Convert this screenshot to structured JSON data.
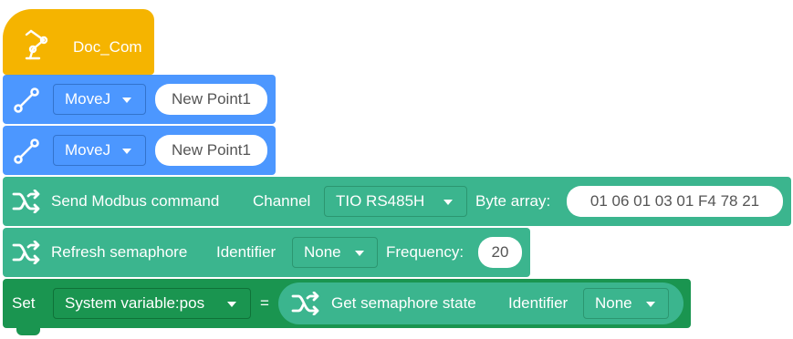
{
  "hat": {
    "title": "Doc_Com",
    "icon": "robot-arm-icon"
  },
  "move_blocks": [
    {
      "mode": "MoveJ",
      "point": "New Point1",
      "icon": "path-line-icon"
    },
    {
      "mode": "MoveJ",
      "point": "New Point1",
      "icon": "path-line-icon"
    }
  ],
  "modbus": {
    "icon": "shuffle-icon",
    "label": "Send Modbus command",
    "channel_label": "Channel",
    "channel_value": "TIO RS485H",
    "bytes_label": "Byte array:",
    "bytes_value": "01 06 01 03 01 F4 78 21"
  },
  "refresh": {
    "icon": "shuffle-icon",
    "label": "Refresh semaphore",
    "identifier_label": "Identifier",
    "identifier_value": "None",
    "frequency_label": "Frequency:",
    "frequency_value": "20"
  },
  "set_block": {
    "label": "Set",
    "variable": "System variable:pos",
    "equals": "=",
    "get": {
      "icon": "shuffle-icon",
      "label": "Get semaphore state",
      "identifier_label": "Identifier",
      "identifier_value": "None"
    }
  },
  "colors": {
    "hat": "#f5b400",
    "move": "#4c97ff",
    "move_dark": "#3373cc",
    "teal": "#3bb58e",
    "teal_dark": "#2c9670",
    "green": "#1a9550",
    "green_dark": "#0f7238"
  }
}
